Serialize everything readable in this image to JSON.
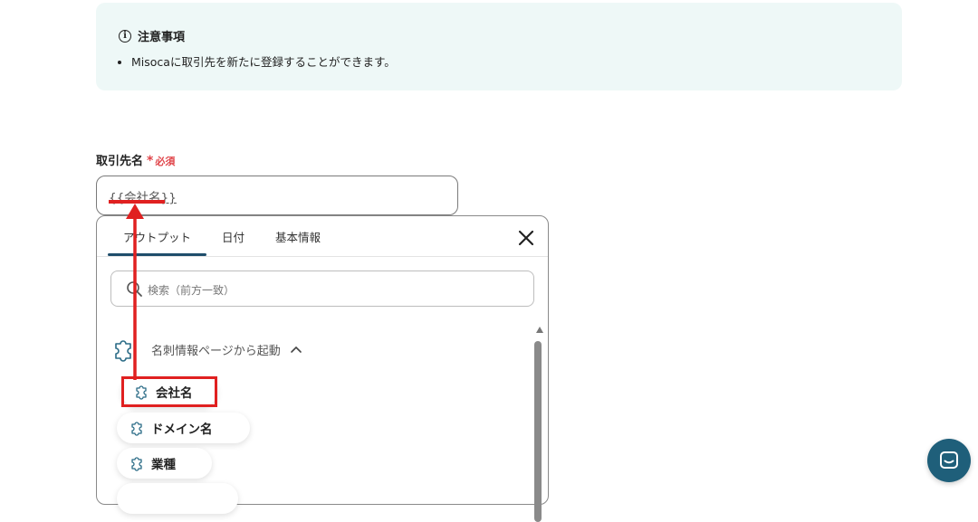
{
  "notice": {
    "title": "注意事項",
    "items": [
      "Misocaに取引先を新たに登録することができます。"
    ]
  },
  "field": {
    "label": "取引先名",
    "required_mark": "*",
    "required_text": "必須",
    "value": "{{会社名}}"
  },
  "dropdown": {
    "tabs": [
      {
        "label": "アウトプット",
        "active": true
      },
      {
        "label": "日付",
        "active": false
      },
      {
        "label": "基本情報",
        "active": false
      }
    ],
    "search_placeholder": "検索（前方一致）",
    "section": {
      "label": "名刺情報ページから起動",
      "expanded": true
    },
    "items": [
      {
        "label": "会社名",
        "selected": true
      },
      {
        "label": "ドメイン名",
        "selected": false
      },
      {
        "label": "業種",
        "selected": false
      }
    ]
  },
  "colors": {
    "accent": "#1e4d6b",
    "required": "#e0454a",
    "annotation": "#e02020",
    "notice_bg": "#eef8f7",
    "chat_button": "#1f5f7a"
  }
}
